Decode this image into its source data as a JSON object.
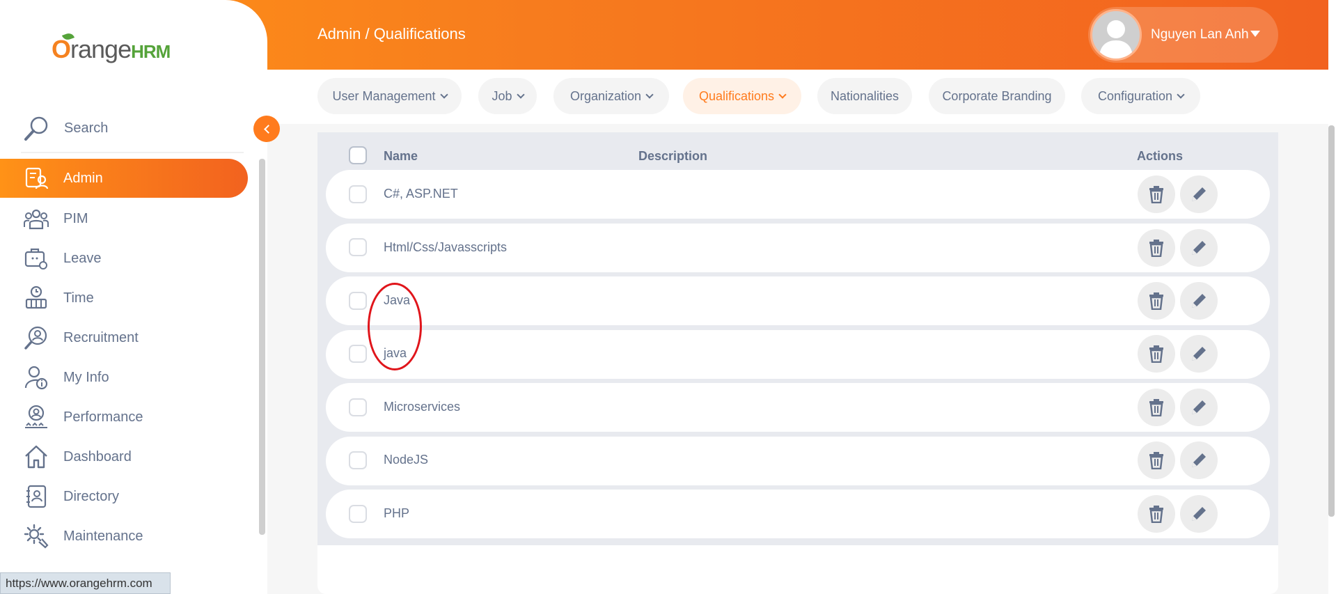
{
  "header": {
    "breadcrumb": "Admin / Qualifications",
    "user_name": "Nguyen Lan Anh",
    "accent_color": "#ff7b1d"
  },
  "brand": {
    "logo_orange": "O",
    "logo_text": "range",
    "logo_hrm": "HRM"
  },
  "sidebar": {
    "search_label": "Search",
    "items": [
      {
        "label": "Admin",
        "icon": "admin-icon",
        "active": true
      },
      {
        "label": "PIM",
        "icon": "pim-icon"
      },
      {
        "label": "Leave",
        "icon": "leave-icon"
      },
      {
        "label": "Time",
        "icon": "time-icon"
      },
      {
        "label": "Recruitment",
        "icon": "recruitment-icon"
      },
      {
        "label": "My Info",
        "icon": "my-info-icon"
      },
      {
        "label": "Performance",
        "icon": "performance-icon"
      },
      {
        "label": "Dashboard",
        "icon": "dashboard-icon"
      },
      {
        "label": "Directory",
        "icon": "directory-icon"
      },
      {
        "label": "Maintenance",
        "icon": "maintenance-icon"
      }
    ]
  },
  "tabs": [
    {
      "label": "User Management",
      "dropdown": true
    },
    {
      "label": "Job",
      "dropdown": true
    },
    {
      "label": "Organization",
      "dropdown": true
    },
    {
      "label": "Qualifications",
      "dropdown": true,
      "active": true
    },
    {
      "label": "Nationalities",
      "dropdown": false
    },
    {
      "label": "Corporate Branding",
      "dropdown": false
    },
    {
      "label": "Configuration",
      "dropdown": true
    }
  ],
  "table": {
    "columns": [
      "Name",
      "Description",
      "Actions"
    ],
    "rows": [
      {
        "name": "C#, ASP.NET",
        "description": ""
      },
      {
        "name": "Html/Css/Javasscripts",
        "description": ""
      },
      {
        "name": "Java",
        "description": ""
      },
      {
        "name": "java",
        "description": ""
      },
      {
        "name": "Microservices",
        "description": ""
      },
      {
        "name": "NodeJS",
        "description": ""
      },
      {
        "name": "PHP",
        "description": ""
      }
    ]
  },
  "status_bar": {
    "url": "https://www.orangehrm.com"
  }
}
